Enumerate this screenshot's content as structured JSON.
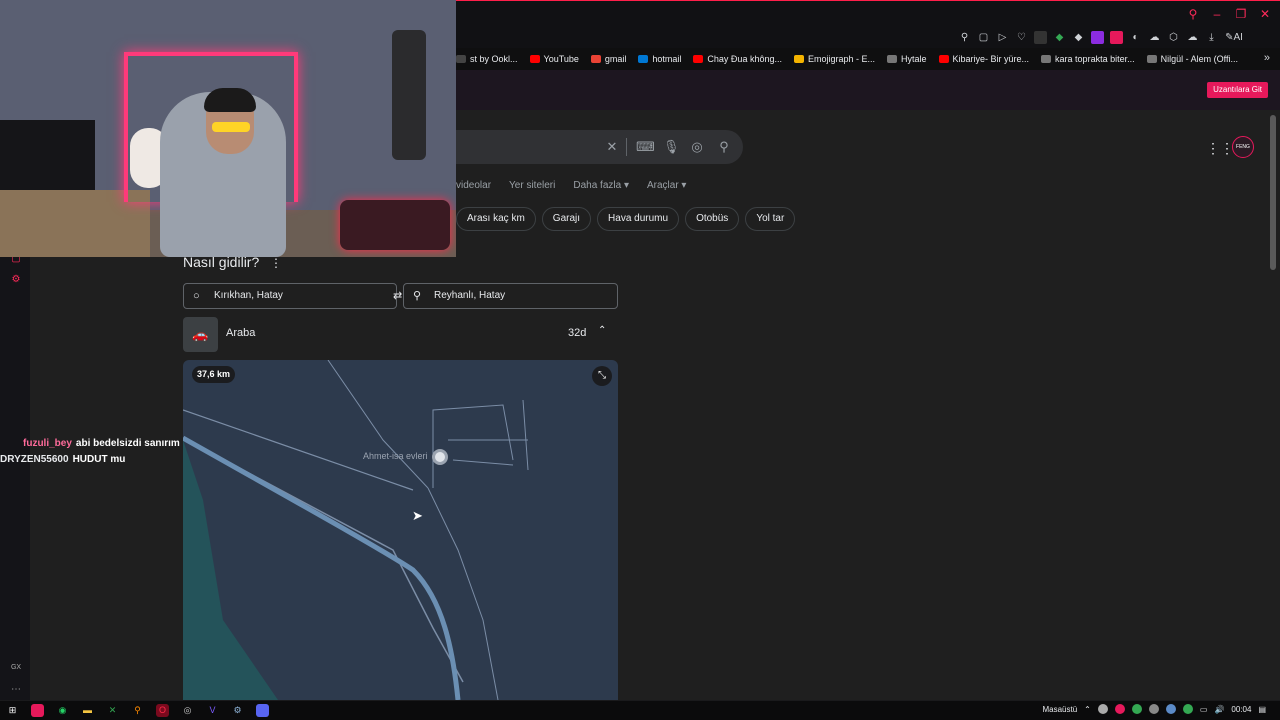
{
  "bookmarks": [
    {
      "label": "st by Ookl...",
      "color": "#444"
    },
    {
      "label": "YouTube",
      "color": "#ff0000"
    },
    {
      "label": "gmail",
      "color": "#ea4335"
    },
    {
      "label": "hotmail",
      "color": "#0078d4"
    },
    {
      "label": "Chay Đua không...",
      "color": "#ff0000"
    },
    {
      "label": "Emojigraph - E...",
      "color": "#f4b400"
    },
    {
      "label": "Hytale",
      "color": "#777"
    },
    {
      "label": "Kibariye- Bir yüre...",
      "color": "#ff0000"
    },
    {
      "label": "kara toprakta biter...",
      "color": "#777"
    },
    {
      "label": "Nilgül - Alem (Offi...",
      "color": "#777"
    }
  ],
  "extension_button": "Uzantılara Git",
  "search_tabs": [
    "videolar",
    "Yer siteleri",
    "Daha fazla ▾",
    "Araçlar ▾"
  ],
  "chips": [
    "Arası kaç km",
    "Garajı",
    "Hava durumu",
    "Otobüs",
    "Yol tar"
  ],
  "profile_text": "FENG",
  "directions": {
    "title": "Nasıl gidilir?",
    "from": "Kırıkhan, Hatay",
    "to": "Reyhanlı, Hatay",
    "mode": "Araba",
    "duration": "32d",
    "distance": "37,6 km",
    "place_label": "Ahmet-isa evleri"
  },
  "chat": [
    {
      "user": "fuzuli_bey",
      "message": "abi bedelsizdi sanırım"
    },
    {
      "user": "DRYZEN55600",
      "message": "HUDUT mu"
    }
  ],
  "taskbar": {
    "desktop_label": "Masaüstü",
    "time": "00:04"
  },
  "colors": {
    "accent": "#e6195b",
    "map_bg": "#2d3a4d",
    "road_main": "#6b8fb3"
  }
}
